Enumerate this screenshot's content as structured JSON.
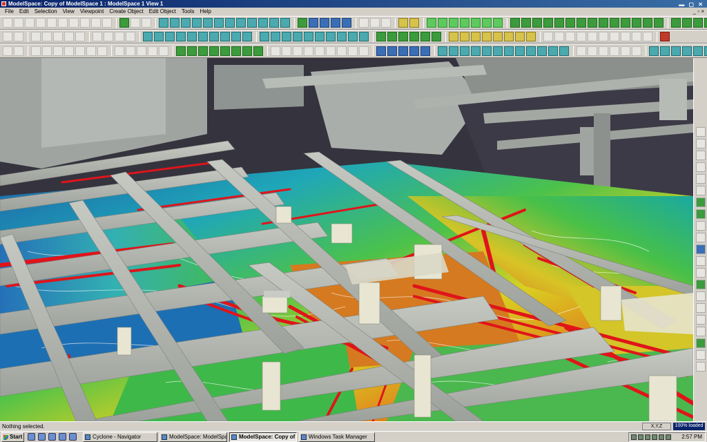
{
  "window": {
    "title": "ModelSpace: Copy of ModelSpace 1 : ModelSpace 1 View 1"
  },
  "menu": {
    "items": [
      "File",
      "Edit",
      "Selection",
      "View",
      "Viewpoint",
      "Create Object",
      "Edit Object",
      "Tools",
      "Help"
    ],
    "right": "_ ▫ ×"
  },
  "status": {
    "message": "Nothing selected.",
    "coords": "X,Y,Z",
    "loaded": "100% loaded"
  },
  "taskbar": {
    "start": "Start",
    "tasks": [
      {
        "label": "Cyclone - Navigator",
        "active": false
      },
      {
        "label": "ModelSpace: ModelSpac...",
        "active": false
      },
      {
        "label": "ModelSpace: Copy of ...",
        "active": true
      },
      {
        "label": "Windows Task Manager",
        "active": false
      }
    ],
    "clock": "2:57 PM"
  },
  "icons": {
    "toolbar1": [
      "select-arrow-icon",
      "pick-icon",
      "hand-pan-icon",
      "pen-icon",
      "box-select-icon",
      "rect-icon",
      "move-icon",
      "rotate-icon",
      "zoom-icon",
      "seek-icon",
      "sep",
      "fit-view-icon",
      "cube-view-icon",
      "pencil-icon",
      "sep",
      "cylinder-icon",
      "cylinder-icon",
      "cylinder-icon",
      "cylinder-icon",
      "pipe-icon",
      "pipe-icon",
      "pipe-icon",
      "pipe-icon",
      "pipe-icon",
      "pipe-icon",
      "pipe-icon",
      "pipe-icon",
      "sep",
      "mesh-icon",
      "point-icon",
      "point-icon",
      "point-icon",
      "point-icon",
      "sep",
      "grid-icon",
      "grid-icon",
      "grid-icon",
      "sep",
      "color-icon",
      "color-icon",
      "sep",
      "green-light-icon",
      "green-light-icon",
      "green-light-icon",
      "green-light-icon",
      "green-light-icon",
      "green-light-icon",
      "green-light-icon",
      "sep",
      "marker-icon",
      "marker-icon",
      "marker-icon",
      "marker-icon",
      "marker-icon",
      "marker-icon",
      "marker-icon",
      "marker-icon",
      "marker-icon",
      "marker-icon",
      "marker-icon",
      "marker-icon",
      "marker-icon",
      "marker-icon",
      "sep",
      "cloud-icon",
      "cloud-icon",
      "cloud-icon",
      "cloud-icon",
      "cloud-icon",
      "sep",
      "render-icon",
      "render-icon",
      "render-icon"
    ],
    "toolbar2": [
      "undo-icon",
      "redo-icon",
      "sep",
      "snap-icon",
      "snap-icon",
      "snap-icon",
      "snap-icon",
      "cut-icon",
      "sep",
      "plane-icon",
      "plane-icon",
      "plane-icon",
      "plane-icon",
      "sep",
      "elbow-icon",
      "elbow-icon",
      "elbow-icon",
      "elbow-icon",
      "elbow-icon",
      "elbow-icon",
      "elbow-icon",
      "elbow-icon",
      "elbow-icon",
      "elbow-icon",
      "sep",
      "tee-icon",
      "tee-icon",
      "tee-icon",
      "tee-icon",
      "tee-icon",
      "tee-icon",
      "tee-icon",
      "tee-icon",
      "tee-icon",
      "tee-icon",
      "sep",
      "fit-icon",
      "fit-icon",
      "fit-icon",
      "fit-icon",
      "fit-icon",
      "fit-icon",
      "sep",
      "flange-icon",
      "flange-icon",
      "flange-icon",
      "flange-icon",
      "flange-icon",
      "flange-icon",
      "flange-icon",
      "flange-icon",
      "sep",
      "measure-icon",
      "measure-icon",
      "measure-icon",
      "measure-icon",
      "measure-icon",
      "measure-icon",
      "measure-icon",
      "measure-icon",
      "measure-icon",
      "measure-icon",
      "sep",
      "close-icon"
    ],
    "toolbar3": [
      "line-icon",
      "line-icon",
      "sep",
      "circle-icon",
      "circle-icon",
      "circle-icon",
      "circle-icon",
      "circle-icon",
      "circle-icon",
      "target-icon",
      "sep",
      "path-icon",
      "path-icon",
      "path-icon",
      "path-icon",
      "path-icon",
      "sep",
      "region-icon",
      "region-icon",
      "region-icon",
      "region-icon",
      "region-icon",
      "region-icon",
      "region-icon",
      "region-icon",
      "sep",
      "beam-icon",
      "beam-icon",
      "beam-icon",
      "beam-icon",
      "beam-icon",
      "beam-icon",
      "beam-icon",
      "beam-icon",
      "beam-icon",
      "sep",
      "layer-icon",
      "layer-icon",
      "layer-icon",
      "layer-icon",
      "layer-icon",
      "sep",
      "pipe-run-icon",
      "pipe-run-icon",
      "pipe-run-icon",
      "pipe-run-icon",
      "pipe-run-icon",
      "pipe-run-icon",
      "pipe-run-icon",
      "pipe-run-icon",
      "pipe-run-icon",
      "pipe-run-icon",
      "pipe-run-icon",
      "pipe-run-icon",
      "sep",
      "section-icon",
      "section-icon",
      "section-icon",
      "section-icon",
      "section-icon",
      "section-icon",
      "sep",
      "steel-icon",
      "steel-icon",
      "steel-icon",
      "steel-icon",
      "steel-icon",
      "steel-icon",
      "steel-icon",
      "steel-icon",
      "steel-icon",
      "steel-icon"
    ]
  }
}
